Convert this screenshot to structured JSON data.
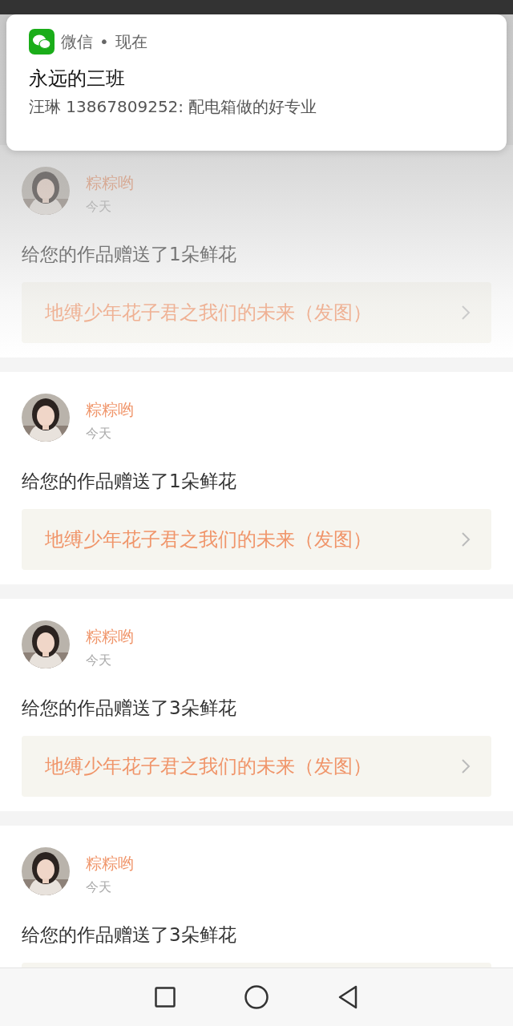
{
  "notification": {
    "app": "微信",
    "separator": "•",
    "time": "现在",
    "title": "永远的三班",
    "message": "汪琳 13867809252: 配电箱做的好专业"
  },
  "feed": [
    {
      "user": "粽粽哟",
      "time": "今天",
      "message": "给您的作品赠送了1朵鲜花",
      "link": "地缚少年花子君之我们的未来（发图）",
      "faded": true
    },
    {
      "user": "粽粽哟",
      "time": "今天",
      "message": "给您的作品赠送了1朵鲜花",
      "link": "地缚少年花子君之我们的未来（发图）",
      "faded": false
    },
    {
      "user": "粽粽哟",
      "time": "今天",
      "message": "给您的作品赠送了3朵鲜花",
      "link": "地缚少年花子君之我们的未来（发图）",
      "faded": false
    },
    {
      "user": "粽粽哟",
      "time": "今天",
      "message": "给您的作品赠送了3朵鲜花",
      "faded": false
    }
  ]
}
